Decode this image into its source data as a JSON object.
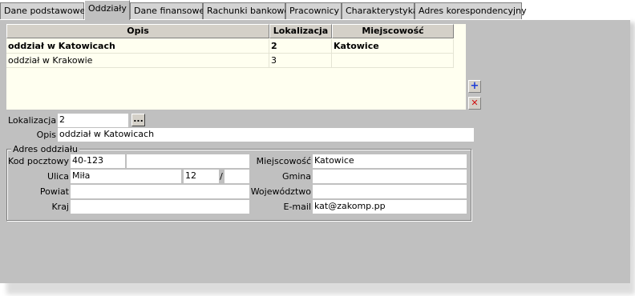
{
  "tabs": [
    {
      "label": "Dane podstawowe"
    },
    {
      "label": "Oddziały"
    },
    {
      "label": "Dane finansowe"
    },
    {
      "label": "Rachunki bankowe"
    },
    {
      "label": "Pracownicy"
    },
    {
      "label": "Charakterystyka"
    },
    {
      "label": "Adres korespondencyjny"
    }
  ],
  "grid": {
    "columns": [
      "Opis",
      "Lokalizacja",
      "Miejscowość"
    ],
    "rows": [
      {
        "opis": "oddział w Katowicach",
        "lokalizacja": "2",
        "miejscowosc": "Katowice"
      },
      {
        "opis": "oddział w Krakowie",
        "lokalizacja": "3",
        "miejscowosc": ""
      }
    ]
  },
  "side_buttons": {
    "add": "+",
    "delete": "✕"
  },
  "form": {
    "lokalizacja_label": "Lokalizacja",
    "lokalizacja_value": "2",
    "browse_label": "...",
    "opis_label": "Opis",
    "opis_value": "oddział w Katowicach"
  },
  "address": {
    "group_title": "Adres oddziału",
    "kod_label": "Kod pocztowy",
    "kod_value": "40-123",
    "kod_extra": "",
    "ulica_label": "Ulica",
    "ulica_value": "Miła",
    "nr_domu": "12",
    "separator": "/",
    "nr_lokalu": "",
    "powiat_label": "Powiat",
    "powiat_value": "",
    "kraj_label": "Kraj",
    "kraj_value": "",
    "miejscowosc_label": "Miejscowość",
    "miejscowosc_value": "Katowice",
    "gmina_label": "Gmina",
    "gmina_value": "",
    "wojewodztwo_label": "Województwo",
    "wojewodztwo_value": "",
    "email_label": "E-mail",
    "email_value": "kat@zakomp.pp"
  },
  "colors": {
    "add_icon": "#1c3cd8",
    "delete_icon": "#d01010",
    "grid_bg": "#fffff0"
  }
}
